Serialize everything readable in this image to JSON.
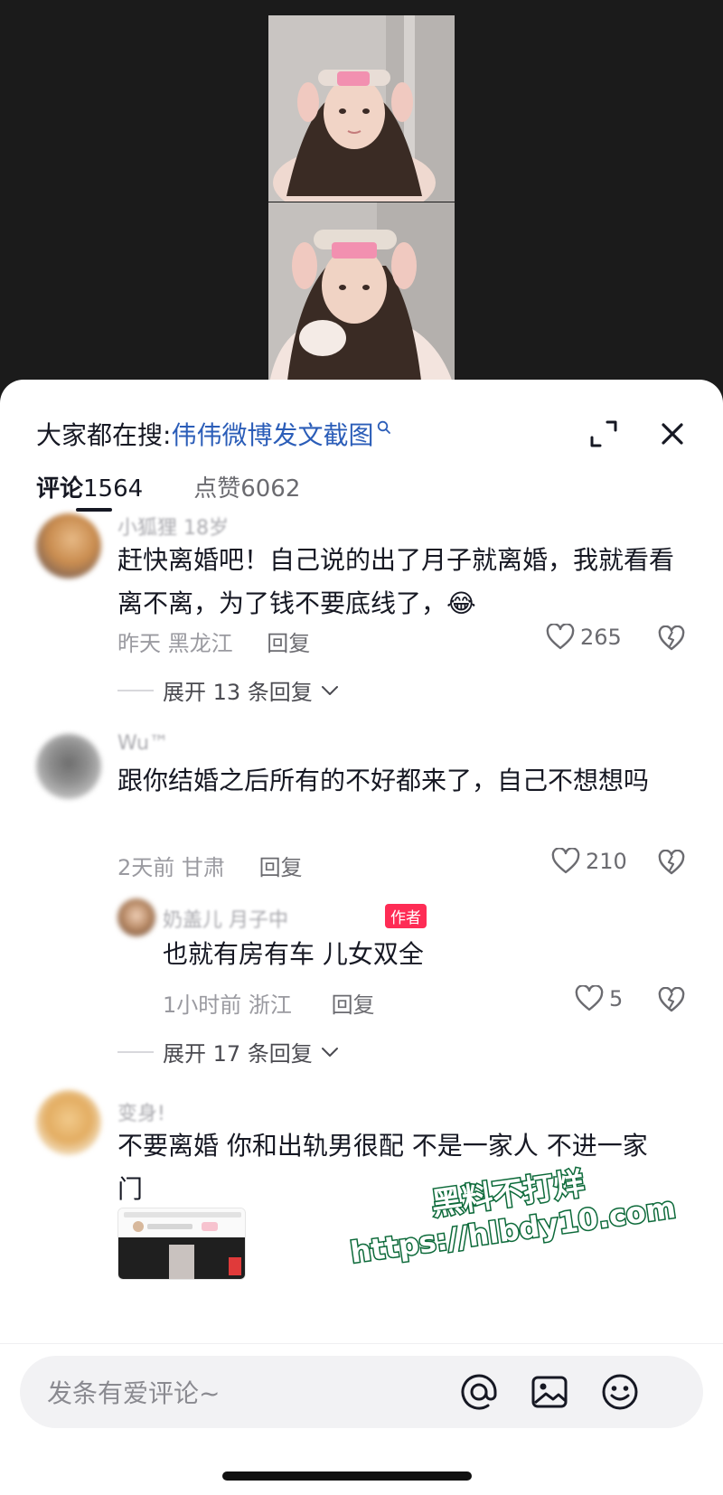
{
  "search": {
    "prefix": "大家都在搜:",
    "term": "伟伟微博发文截图",
    "magnifier_icon": "search-icon"
  },
  "tabs": [
    {
      "label": "评论",
      "count": "1564"
    },
    {
      "label": "点赞",
      "count": "6062"
    }
  ],
  "comments": [
    {
      "username": "小狐狸 18岁",
      "text": "赶快离婚吧！自己说的出了月子就离婚，我就看看离不离，为了钱不要底线了，😂",
      "time": "昨天",
      "location": "黑龙江",
      "reply_label": "回复",
      "likes": "265",
      "expand": "展开 13 条回复"
    },
    {
      "username": "Wu™",
      "text": "跟你结婚之后所有的不好都来了，自己不想想吗",
      "time": "2天前",
      "location": "甘肃",
      "reply_label": "回复",
      "likes": "210",
      "reply": {
        "username": "奶盖儿 月子中",
        "badge": "作者",
        "text": "也就有房有车 儿女双全",
        "time": "1小时前",
        "location": "浙江",
        "reply_label": "回复",
        "likes": "5"
      },
      "expand": "展开 17 条回复"
    },
    {
      "username": "变身!",
      "text": "不要离婚 你和出轨男很配 不是一家人 不进一家门"
    }
  ],
  "watermark": {
    "line1": "黑料不打烊",
    "line2": "https://hlbdy10.com"
  },
  "input": {
    "placeholder": "发条有爱评论~",
    "icons": [
      "at-icon",
      "image-icon",
      "emoji-icon"
    ]
  },
  "colors": {
    "search_term": "#2b5db8",
    "author_badge": "#fe2c55",
    "watermark_stroke": "#0d6a3a"
  }
}
